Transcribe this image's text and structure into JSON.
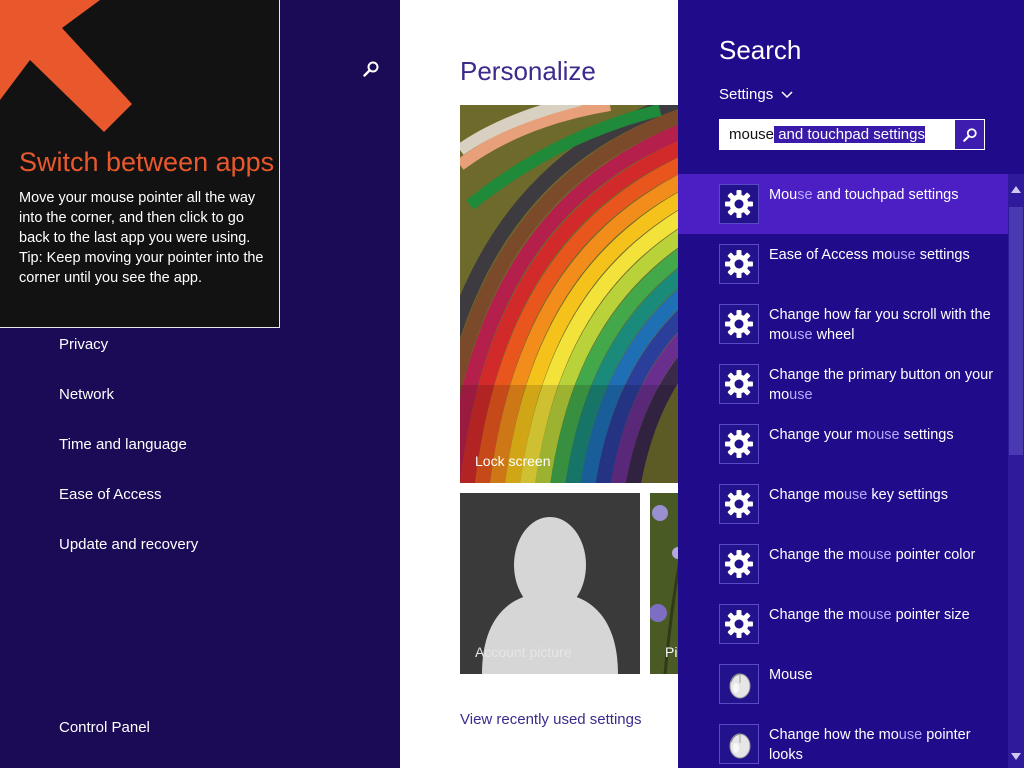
{
  "left_nav": {
    "items": [
      {
        "label": "Privacy"
      },
      {
        "label": "Network"
      },
      {
        "label": "Time and language"
      },
      {
        "label": "Ease of Access"
      },
      {
        "label": "Update and recovery"
      }
    ],
    "footer_link": "Control Panel",
    "search_icon": "search-icon"
  },
  "tip": {
    "title": "Switch between apps",
    "line1": "Move your mouse pointer all the way into the corner, and then click to go back to the last app you were using.",
    "line2": "Tip: Keep moving your pointer into the corner until you see the app.",
    "arrow_color": "#e8582c"
  },
  "personalize": {
    "title": "Personalize",
    "lock_screen_label": "Lock screen",
    "account_picture_label": "Account picture",
    "picture_password_label": "Pi",
    "recent_link": "View recently used settings"
  },
  "search": {
    "title": "Search",
    "scope": "Settings",
    "query_typed": "mouse",
    "query_suggestion": " and touchpad settings",
    "go_icon": "search-icon"
  },
  "results": [
    {
      "pre": "Mou",
      "hl": "se",
      "post": " and touchpad settings",
      "icon": "gear-icon",
      "selected": true
    },
    {
      "pre": "Ease of Access mo",
      "hl": "use",
      "post": " settings",
      "icon": "gear-icon"
    },
    {
      "pre": "Change how far you scroll with the mo",
      "hl": "use",
      "post": " wheel",
      "icon": "gear-icon"
    },
    {
      "pre": "Change the primary button on your mo",
      "hl": "use",
      "post": "",
      "icon": "gear-icon"
    },
    {
      "pre": "Change your m",
      "hl": "ouse",
      "post": " settings",
      "icon": "gear-icon"
    },
    {
      "pre": "Change mo",
      "hl": "use",
      "post": " key settings",
      "icon": "gear-icon"
    },
    {
      "pre": "Change the m",
      "hl": "ouse",
      "post": " pointer color",
      "icon": "gear-icon"
    },
    {
      "pre": "Change the m",
      "hl": "ouse",
      "post": " pointer size",
      "icon": "gear-icon"
    },
    {
      "pre": "Mouse",
      "hl": "",
      "post": "",
      "icon": "mouse-icon"
    },
    {
      "pre": "Change how the mo",
      "hl": "use",
      "post": " pointer looks",
      "icon": "mouse-icon"
    }
  ],
  "colors": {
    "nav_background": "#1b0a56",
    "charm_background": "#200c8a",
    "selected_result": "#4b1fc4",
    "match_highlight": "#b9a9ff"
  }
}
